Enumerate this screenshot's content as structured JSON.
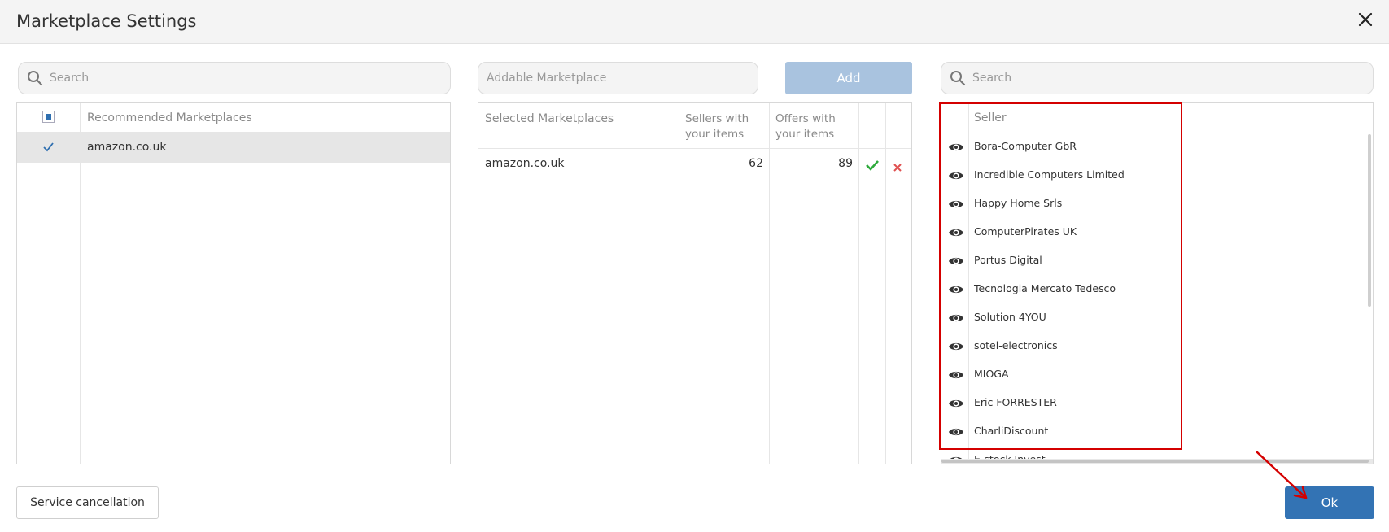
{
  "dialog": {
    "title": "Marketplace Settings"
  },
  "left_panel": {
    "search_placeholder": "Search",
    "column_header": "Recommended Marketplaces",
    "rows": [
      {
        "label": "amazon.co.uk",
        "checked": true
      }
    ]
  },
  "middle_panel": {
    "addable_placeholder": "Addable Marketplace",
    "add_label": "Add",
    "headers": {
      "selected": "Selected Marketplaces",
      "sellers_line1": "Sellers with",
      "sellers_line2": "your items",
      "offers_line1": "Offers with",
      "offers_line2": "your items"
    },
    "rows": [
      {
        "marketplace": "amazon.co.uk",
        "sellers": "62",
        "offers": "89"
      }
    ]
  },
  "right_panel": {
    "search_placeholder": "Search",
    "column_header": "Seller",
    "sellers": [
      "Bora-Computer GbR",
      "Incredible Computers Limited",
      "Happy Home Srls",
      "ComputerPirates UK",
      "Portus Digital",
      "Tecnologia Mercato Tedesco",
      "Solution 4YOU",
      "sotel-electronics",
      "MIOGA",
      "Eric FORRESTER",
      "CharliDiscount",
      "E-stock Invest"
    ]
  },
  "footer": {
    "service_cancellation_label": "Service cancellation",
    "ok_label": "Ok"
  },
  "colors": {
    "primary_button": "#3373b4",
    "disabled_button": "#a9c3df",
    "highlight": "#d40000",
    "check_green": "#2eaa3c",
    "remove_red": "#e05050"
  }
}
